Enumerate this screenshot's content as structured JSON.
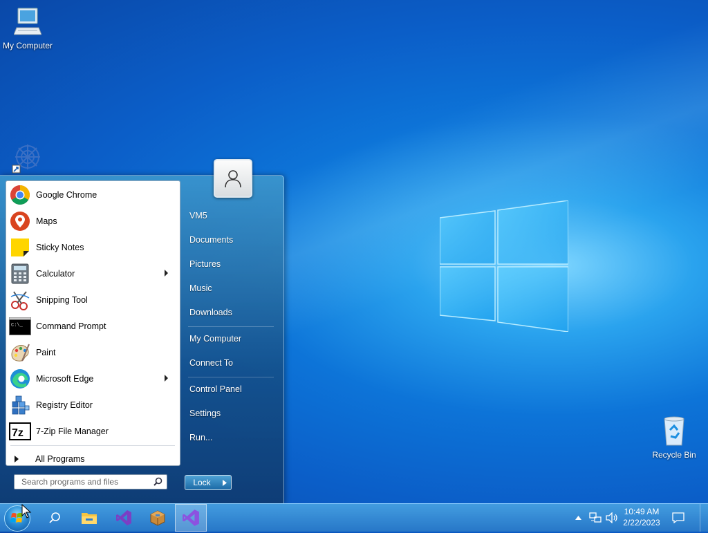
{
  "desktop": {
    "icons": [
      {
        "label": "My Computer",
        "icon": "computer-icon"
      },
      {
        "label": "",
        "icon": "shortcut-app-icon"
      },
      {
        "label": "Recycle Bin",
        "icon": "recycle-bin-icon"
      }
    ]
  },
  "start_menu": {
    "programs": [
      {
        "label": "Google Chrome",
        "icon": "chrome-icon",
        "has_submenu": false
      },
      {
        "label": "Maps",
        "icon": "maps-icon",
        "has_submenu": false
      },
      {
        "label": "Sticky Notes",
        "icon": "sticky-notes-icon",
        "has_submenu": false
      },
      {
        "label": "Calculator",
        "icon": "calculator-icon",
        "has_submenu": true
      },
      {
        "label": "Snipping Tool",
        "icon": "snipping-tool-icon",
        "has_submenu": false
      },
      {
        "label": "Command Prompt",
        "icon": "command-prompt-icon",
        "has_submenu": false
      },
      {
        "label": "Paint",
        "icon": "paint-icon",
        "has_submenu": false
      },
      {
        "label": "Microsoft Edge",
        "icon": "edge-icon",
        "has_submenu": true
      },
      {
        "label": "Registry Editor",
        "icon": "registry-editor-icon",
        "has_submenu": false
      },
      {
        "label": "7-Zip File Manager",
        "icon": "7zip-icon",
        "has_submenu": false
      }
    ],
    "cmd_icon_text": "C:\\_",
    "sevenzip_icon_text": "7z",
    "all_programs": "All Programs",
    "search_placeholder": "Search programs and files",
    "right_links": [
      "VM5",
      "Documents",
      "Pictures",
      "Music",
      "Downloads",
      "My Computer",
      "Connect To",
      "Control Panel",
      "Settings",
      "Run..."
    ],
    "lock_label": "Lock"
  },
  "taskbar": {
    "items": [
      "start-orb",
      "search-icon",
      "file-explorer-icon",
      "visual-studio-icon",
      "package-icon",
      "visual-studio-active-icon"
    ],
    "clock": {
      "time": "10:49 AM",
      "date": "2/22/2023"
    }
  },
  "colors": {
    "accent": "#0b6fd6",
    "taskbar": "#2f86d4"
  }
}
